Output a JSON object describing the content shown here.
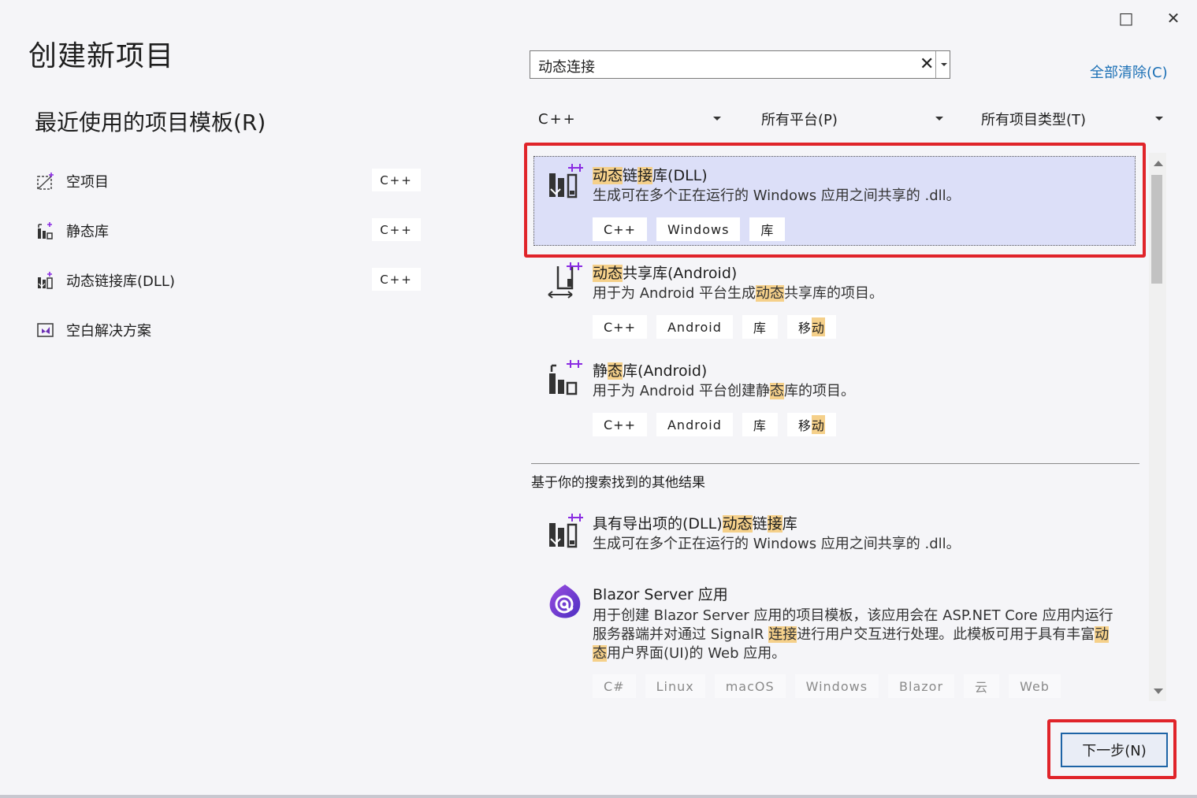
{
  "window": {
    "title": "创建新项目",
    "maximize_icon": "□",
    "close_icon": "✕"
  },
  "recent": {
    "title": "最近使用的项目模板(R)",
    "items": [
      {
        "label": "空项目",
        "tag": "C++",
        "icon": "empty-project-icon"
      },
      {
        "label": "静态库",
        "tag": "C++",
        "icon": "static-library-icon"
      },
      {
        "label": "动态链接库(DLL)",
        "tag": "C++",
        "icon": "dll-icon"
      },
      {
        "label": "空白解决方案",
        "tag": "",
        "icon": "blank-solution-icon"
      }
    ]
  },
  "search": {
    "value": "动态连接",
    "clear_icon": "✕",
    "clear_all": "全部清除(C)"
  },
  "filters": {
    "language": "C++",
    "platform": "所有平台(P)",
    "project_type": "所有项目类型(T)"
  },
  "results": [
    {
      "title_parts": [
        {
          "t": "动态",
          "h": true
        },
        {
          "t": "链",
          "h": false
        },
        {
          "t": "接",
          "h": true
        },
        {
          "t": "库(DLL)",
          "h": false
        }
      ],
      "desc_parts": [
        {
          "t": "生成可在多个正在运行的 Windows 应用之间共享的 .dll。",
          "h": false
        }
      ],
      "tags": [
        {
          "t": "C++",
          "h": false
        },
        {
          "t": "Windows",
          "h": false
        },
        {
          "t": "库",
          "h": false
        }
      ],
      "selected": true
    },
    {
      "title_parts": [
        {
          "t": "动态",
          "h": true
        },
        {
          "t": "共享库(Android)",
          "h": false
        }
      ],
      "desc_parts": [
        {
          "t": "用于为 Android 平台生成",
          "h": false
        },
        {
          "t": "动态",
          "h": true
        },
        {
          "t": "共享库的项目。",
          "h": false
        }
      ],
      "tags": [
        {
          "t": "C++",
          "h": false
        },
        {
          "t": "Android",
          "h": false
        },
        {
          "t": "库",
          "h": false
        },
        {
          "t": "移",
          "h": false
        },
        {
          "t": "动",
          "h": true
        }
      ]
    },
    {
      "title_parts": [
        {
          "t": "静",
          "h": false
        },
        {
          "t": "态",
          "h": true
        },
        {
          "t": "库(Android)",
          "h": false
        }
      ],
      "desc_parts": [
        {
          "t": "用于为 Android 平台创建静",
          "h": false
        },
        {
          "t": "态",
          "h": true
        },
        {
          "t": "库的项目。",
          "h": false
        }
      ],
      "tags": [
        {
          "t": "C++",
          "h": false
        },
        {
          "t": "Android",
          "h": false
        },
        {
          "t": "库",
          "h": false
        },
        {
          "t": "移",
          "h": false
        },
        {
          "t": "动",
          "h": true
        }
      ]
    }
  ],
  "other_title": "基于你的搜索找到的其他结果",
  "other_results": [
    {
      "title_parts": [
        {
          "t": "具有导出项的(DLL)",
          "h": false
        },
        {
          "t": "动态",
          "h": true
        },
        {
          "t": "链",
          "h": false
        },
        {
          "t": "接",
          "h": true
        },
        {
          "t": "库",
          "h": false
        }
      ],
      "desc_parts": [
        {
          "t": "生成可在多个正在运行的 Windows 应用之间共享的 .dll。",
          "h": false
        }
      ],
      "tags": []
    },
    {
      "title_parts": [
        {
          "t": "Blazor Server 应用",
          "h": false
        }
      ],
      "desc_parts": [
        {
          "t": "用于创建 Blazor Server 应用的项目模板，该应用会在 ASP.NET Core 应用内运行服务器端并对通过 SignalR ",
          "h": false
        },
        {
          "t": "连接",
          "h": true
        },
        {
          "t": "进行用户交互进行处理。此模板可用于具有丰富",
          "h": false
        },
        {
          "t": "动态",
          "h": true
        },
        {
          "t": "用户界面(UI)的 Web 应用。",
          "h": false
        }
      ],
      "tags": [
        {
          "t": "C#",
          "h": false
        },
        {
          "t": "Linux",
          "h": false
        },
        {
          "t": "macOS",
          "h": false
        },
        {
          "t": "Windows",
          "h": false
        },
        {
          "t": "Blazor",
          "h": false
        },
        {
          "t": "云",
          "h": false
        },
        {
          "t": "Web",
          "h": false
        }
      ]
    }
  ],
  "footer": {
    "next_label": "下一步(N)"
  },
  "colors": {
    "highlight": "#f5d08a",
    "selected_bg": "#dcdff8",
    "annotation_red": "#e0242a",
    "link": "#1a6fb5",
    "primary_border": "#1e64a6"
  }
}
